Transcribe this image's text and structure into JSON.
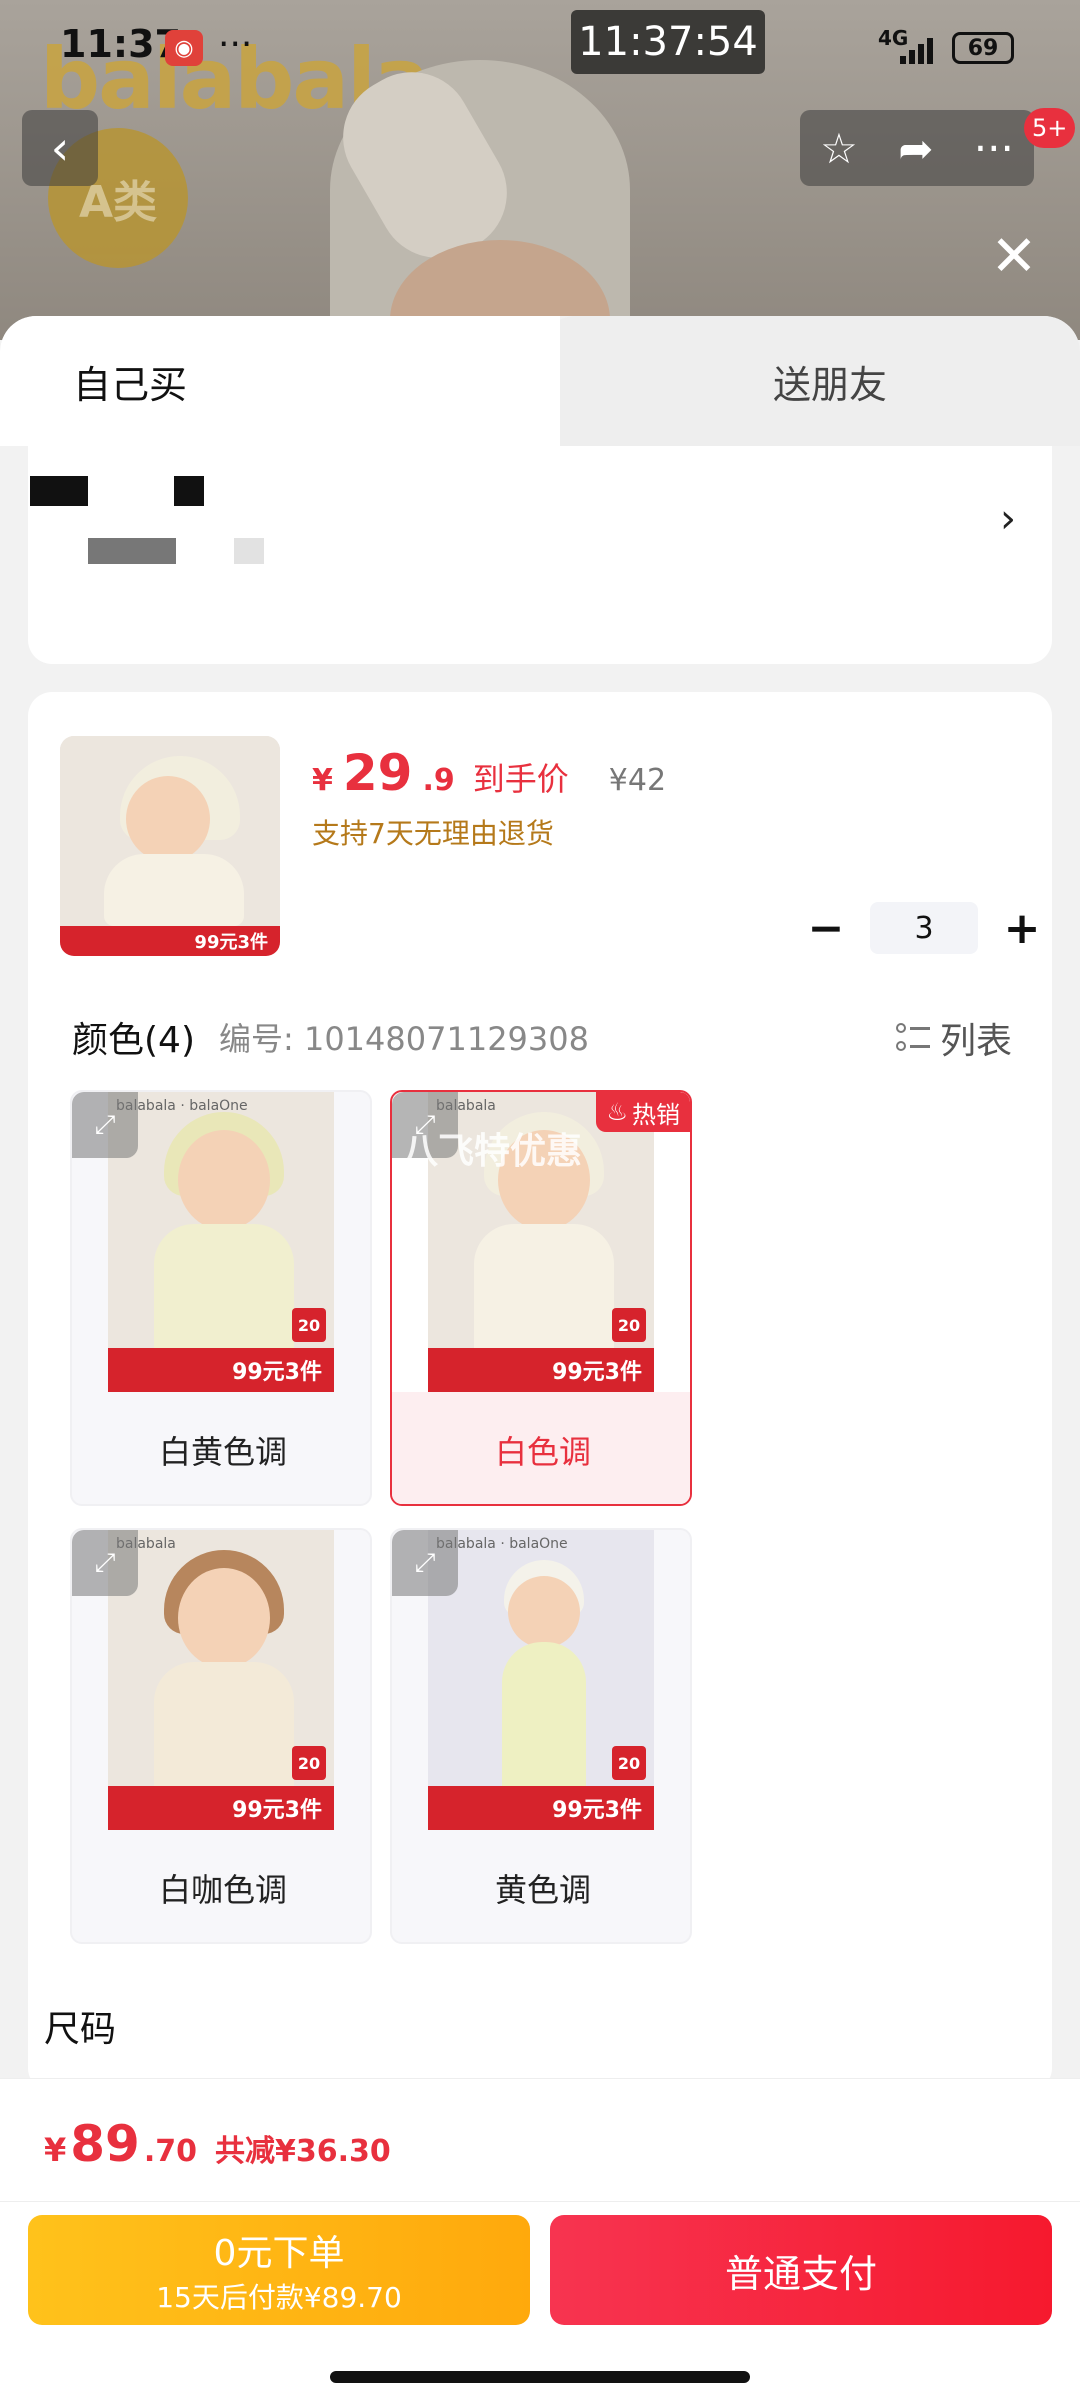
{
  "status_bar": {
    "time": "11:37",
    "clock": "11:37:54",
    "network": "4G",
    "battery": "69"
  },
  "backdrop": {
    "brand": "balabala",
    "badge": "A类"
  },
  "nav": {
    "back_glyph": "‹",
    "notification_count": "5+"
  },
  "tabs": [
    {
      "label": "自己买",
      "active": true
    },
    {
      "label": "送朋友",
      "active": false
    }
  ],
  "product": {
    "price_symbol": "¥",
    "price_int": "29",
    "price_dec": ".9",
    "price_tag": "到手价",
    "original_price": "¥42",
    "return_note": "支持7天无理由退货",
    "quantity": "3"
  },
  "colors": {
    "title": "颜色(4)",
    "sku": "编号: 10148071129308",
    "list_label": "列表",
    "options": [
      {
        "label": "白黄色调",
        "brand": "balabala · balaOne",
        "promo": "99元3件",
        "selected": false
      },
      {
        "label": "白色调",
        "brand": "balabala",
        "promo": "99元3件",
        "selected": true,
        "tag": "热销",
        "overlay": "八飞特优惠"
      },
      {
        "label": "白咖色调",
        "brand": "balabala",
        "promo": "99元3件",
        "selected": false
      },
      {
        "label": "黄色调",
        "brand": "balabala · balaOne",
        "promo": "99元3件",
        "selected": false
      }
    ]
  },
  "size": {
    "title": "尺码"
  },
  "footer": {
    "total_symbol": "¥",
    "total_int": "89",
    "total_dec": ".70",
    "total_save": "共减¥36.30",
    "later_line1": "0元下单",
    "later_line2": "15天后付款¥89.70",
    "pay_label": "普通支付"
  },
  "colors_theme": {
    "accent_red": "#e8303e",
    "accent_yellow": "#ffb514",
    "note_brown": "#b5791a"
  }
}
